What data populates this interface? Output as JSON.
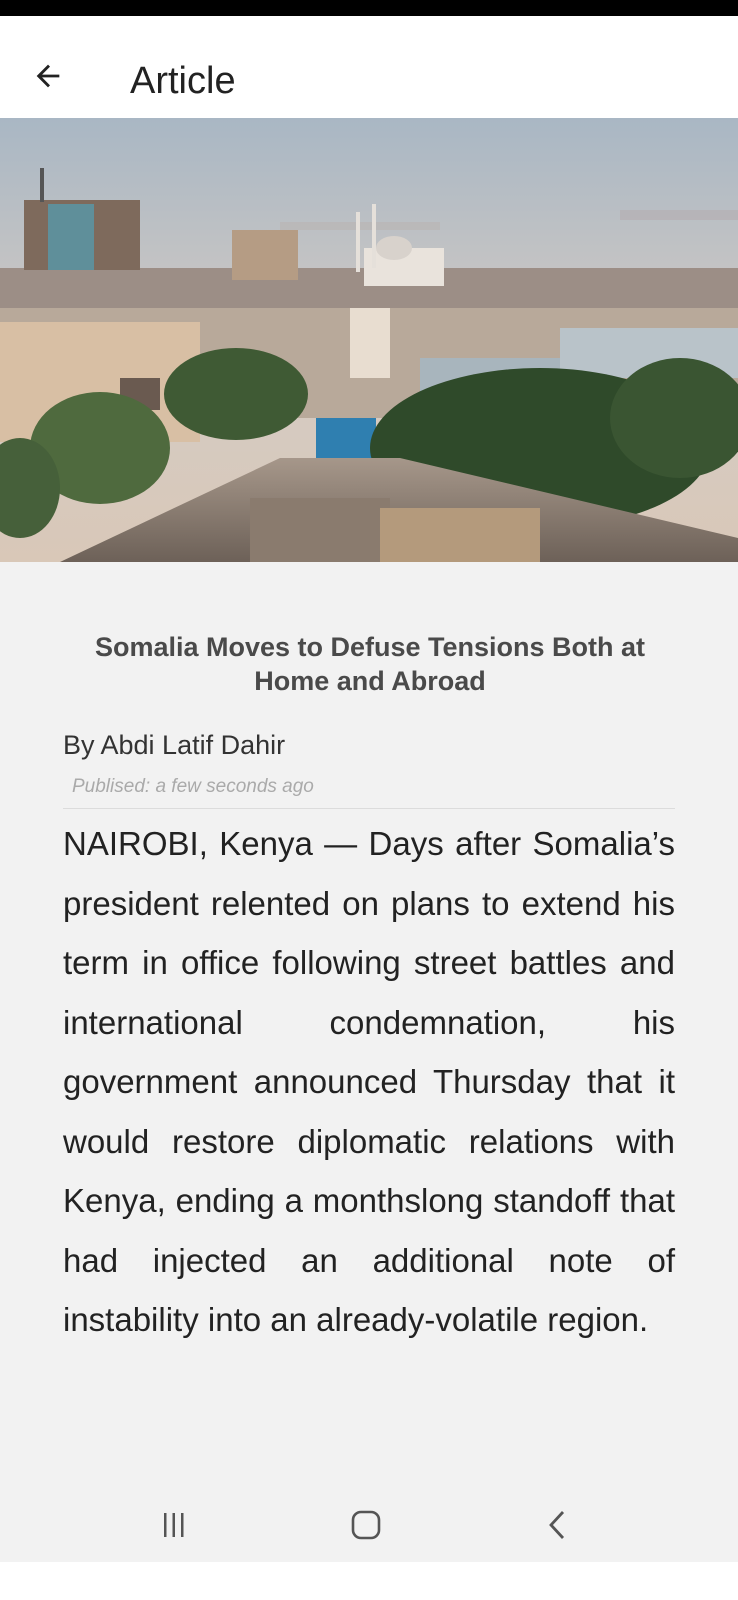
{
  "app_bar": {
    "title": "Article",
    "back_icon": "arrow-left-icon"
  },
  "hero_image": {
    "alt": "Mogadishu skyline"
  },
  "article": {
    "headline": "Somalia Moves to Defuse Tensions Both at Home and Abroad",
    "byline": "By Abdi Latif Dahir",
    "published": "Publised: a few seconds ago",
    "body": "NAIROBI, Kenya — Days after Somalia’s president relented on plans to extend his term in office following street battles and international condemnation, his government announced Thursday that it would restore diplomatic relations with Kenya, ending a monthslong standoff that had injected an additional note of instability into an already-volatile region."
  },
  "nav_bar": {
    "recents_icon": "recents-icon",
    "home_icon": "home-icon",
    "back_icon": "chevron-left-icon"
  }
}
